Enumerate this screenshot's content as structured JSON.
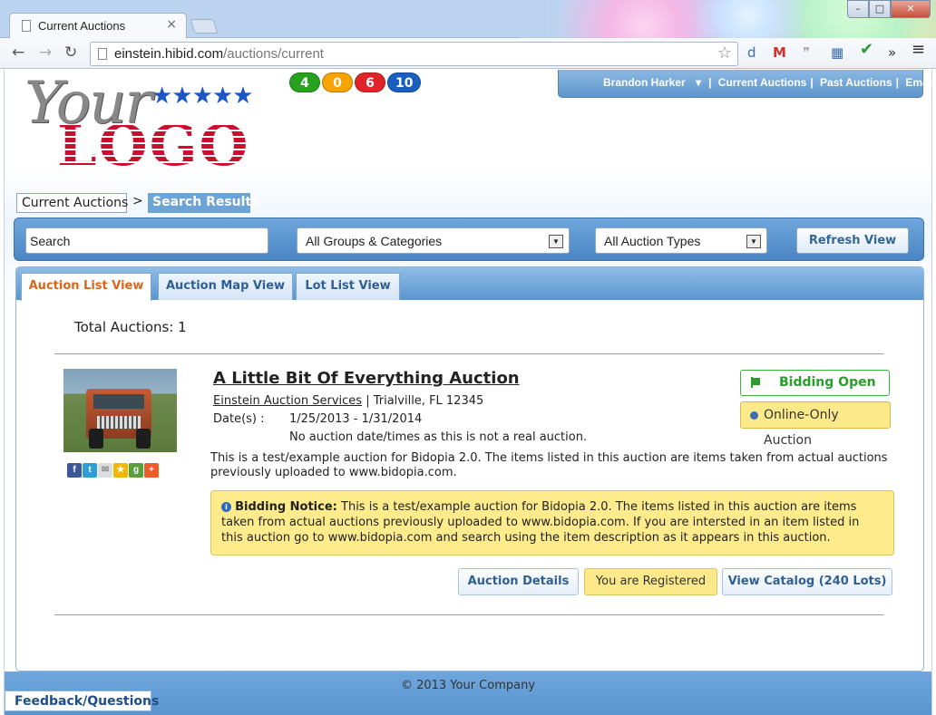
{
  "browser": {
    "tab_title": "Current Auctions",
    "tab_close": "×",
    "url_host": "einstein.hibid.com",
    "url_path": "/auctions/current",
    "window_buttons": {
      "min": "–",
      "max": "□",
      "close": "✕"
    },
    "nav": {
      "back": "←",
      "forward": "→",
      "reload": "↻",
      "bookmark": "☆"
    }
  },
  "header": {
    "logo_your": "Your",
    "logo_logo": "LOGO",
    "logo_stars": "★★★★★",
    "counters": [
      {
        "value": "4",
        "color": "#27a21f"
      },
      {
        "value": "0",
        "color": "#f7a300"
      },
      {
        "value": "6",
        "color": "#e0242b"
      },
      {
        "value": "10",
        "color": "#1a5fbf"
      }
    ],
    "user_menu": {
      "user": "Brandon Harker",
      "links": [
        "Current Auctions",
        "Past Auctions",
        "Email"
      ]
    }
  },
  "breadcrumb": {
    "current": "Current Auctions",
    "separator": ">",
    "active": "Search Results"
  },
  "filters": {
    "search_value": "Search",
    "groups": "All Groups & Categories",
    "types": "All Auction Types",
    "refresh_label": "Refresh View"
  },
  "tabs": [
    {
      "label": "Auction List View",
      "active": true
    },
    {
      "label": "Auction Map View",
      "active": false
    },
    {
      "label": "Lot List View",
      "active": false
    }
  ],
  "results": {
    "total_label": "Total Auctions: 1"
  },
  "auction": {
    "title": "A Little Bit Of Everything Auction",
    "company": "Einstein Auction Services",
    "location": " | Trialville, FL 12345",
    "dates_label": "Date(s) :",
    "dates_value": "1/25/2013 - 1/31/2014",
    "dates_note": "No auction date/times as this is not a real auction.",
    "description": "This is a test/example auction for Bidopia 2.0. The items listed in this auction are items taken from actual auctions previously uploaded to www.bidopia.com.",
    "status_open": "Bidding Open",
    "status_type": "Online-Only Auction",
    "notice_title": "Bidding Notice:",
    "notice_text": "This is a test/example auction for Bidopia 2.0. The items listed in this auction are items taken from actual auctions previously uploaded to www.bidopia.com. If you are intersted in an item listed in this auction go to www.bidopia.com and search using the item description as it appears in this auction.",
    "buttons": {
      "details": "Auction Details",
      "registered": "You are Registered",
      "catalog": "View Catalog (240 Lots)"
    },
    "share_icons": [
      "facebook-icon",
      "twitter-icon",
      "email-icon",
      "favorite-icon",
      "google-plus-icon",
      "add-this-icon"
    ]
  },
  "footer": {
    "copyright": "© 2013 Your Company",
    "feedback": "Feedback/Questions"
  }
}
